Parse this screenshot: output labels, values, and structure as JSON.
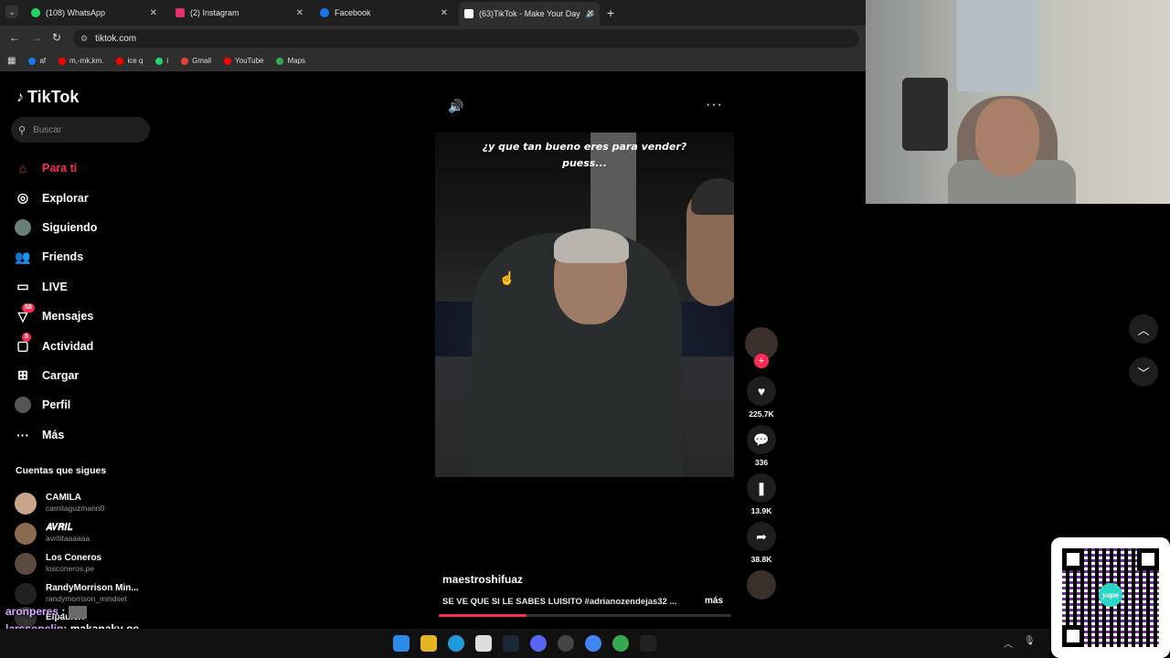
{
  "browser": {
    "tabs": [
      {
        "title": "(108) WhatsApp",
        "icon": "whatsapp-icon",
        "color": "#25d366"
      },
      {
        "title": "(2) Instagram",
        "icon": "instagram-icon",
        "color": "#e1306c"
      },
      {
        "title": "Facebook",
        "icon": "facebook-icon",
        "color": "#1877f2"
      },
      {
        "title": "(63)TikTok - Make Your Day",
        "icon": "tiktok-icon",
        "color": "#ffffff"
      }
    ],
    "url": "tiktok.com",
    "bookmarks": [
      {
        "label": "af",
        "color": "#1877f2"
      },
      {
        "label": "m,-mk,km.",
        "color": "#ff0000"
      },
      {
        "label": "ice q",
        "color": "#ff0000"
      },
      {
        "label": "i",
        "color": "#25d366"
      },
      {
        "label": "Gmail",
        "color": "#ea4335"
      },
      {
        "label": "YouTube",
        "color": "#ff0000"
      },
      {
        "label": "Maps",
        "color": "#34a853"
      }
    ]
  },
  "tiktok": {
    "logo": "TikTok",
    "search_placeholder": "Buscar",
    "nav": [
      {
        "label": "Para ti",
        "icon": "home-icon",
        "active": true
      },
      {
        "label": "Explorar",
        "icon": "compass-icon"
      },
      {
        "label": "Siguiendo",
        "icon": "following-avatar-icon"
      },
      {
        "label": "Friends",
        "icon": "friends-icon"
      },
      {
        "label": "LIVE",
        "icon": "live-icon"
      },
      {
        "label": "Mensajes",
        "icon": "messages-icon",
        "badge": "58"
      },
      {
        "label": "Actividad",
        "icon": "activity-icon",
        "badge": "5"
      },
      {
        "label": "Cargar",
        "icon": "upload-icon"
      },
      {
        "label": "Perfil",
        "icon": "profile-icon"
      },
      {
        "label": "Más",
        "icon": "more-icon"
      }
    ],
    "following_title": "Cuentas que sigues",
    "following": [
      {
        "name": "CAMILA",
        "handle": "camilaguzmann0"
      },
      {
        "name": "𝑨𝑽𝑹𝑰𝑳",
        "handle": "avrilitaaaaaa"
      },
      {
        "name": "Los Coneros",
        "handle": "losconeros.pe"
      },
      {
        "name": "RandyMorrison Min...",
        "handle": "randymorrison_mindset"
      },
      {
        "name": "ElpauleX",
        "handle": ""
      }
    ],
    "video": {
      "caption_line1": "¿y que tan bueno eres para vender?",
      "caption_line2": "puess...",
      "author": "maestroshifuaz",
      "description": "SE VE QUE SI LE SABES LUISITO #adrianozendejas32 ...",
      "more_label": "más",
      "progress": 0.3
    },
    "actions": {
      "likes": "225.7K",
      "comments": "336",
      "saves": "13.9K",
      "shares": "38.8K"
    }
  },
  "chat": [
    {
      "user": "aronperes",
      "message": ":"
    },
    {
      "user": "larssonclip",
      "message": ": makanaky oe"
    }
  ],
  "qr_label": "yape"
}
